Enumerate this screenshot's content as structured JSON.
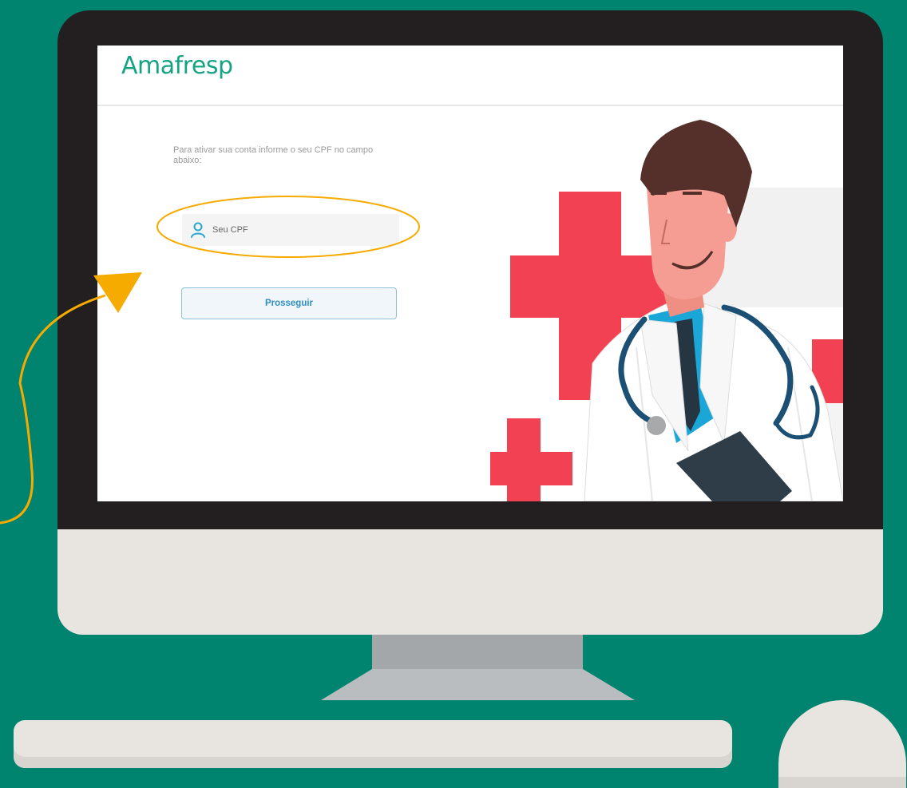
{
  "brand": {
    "logo_text": "Amafresp",
    "color": "#14a383"
  },
  "form": {
    "instruction": "Para ativar sua conta informe o seu CPF no campo abaixo:",
    "cpf_placeholder": "Seu CPF",
    "proceed_label": "Prosseguir"
  },
  "icons": {
    "cpf_field": "user-icon"
  },
  "colors": {
    "background": "#00836f",
    "annotation": "#f5ab00",
    "cross": "#f24153",
    "button_text": "#2f8fbe"
  }
}
